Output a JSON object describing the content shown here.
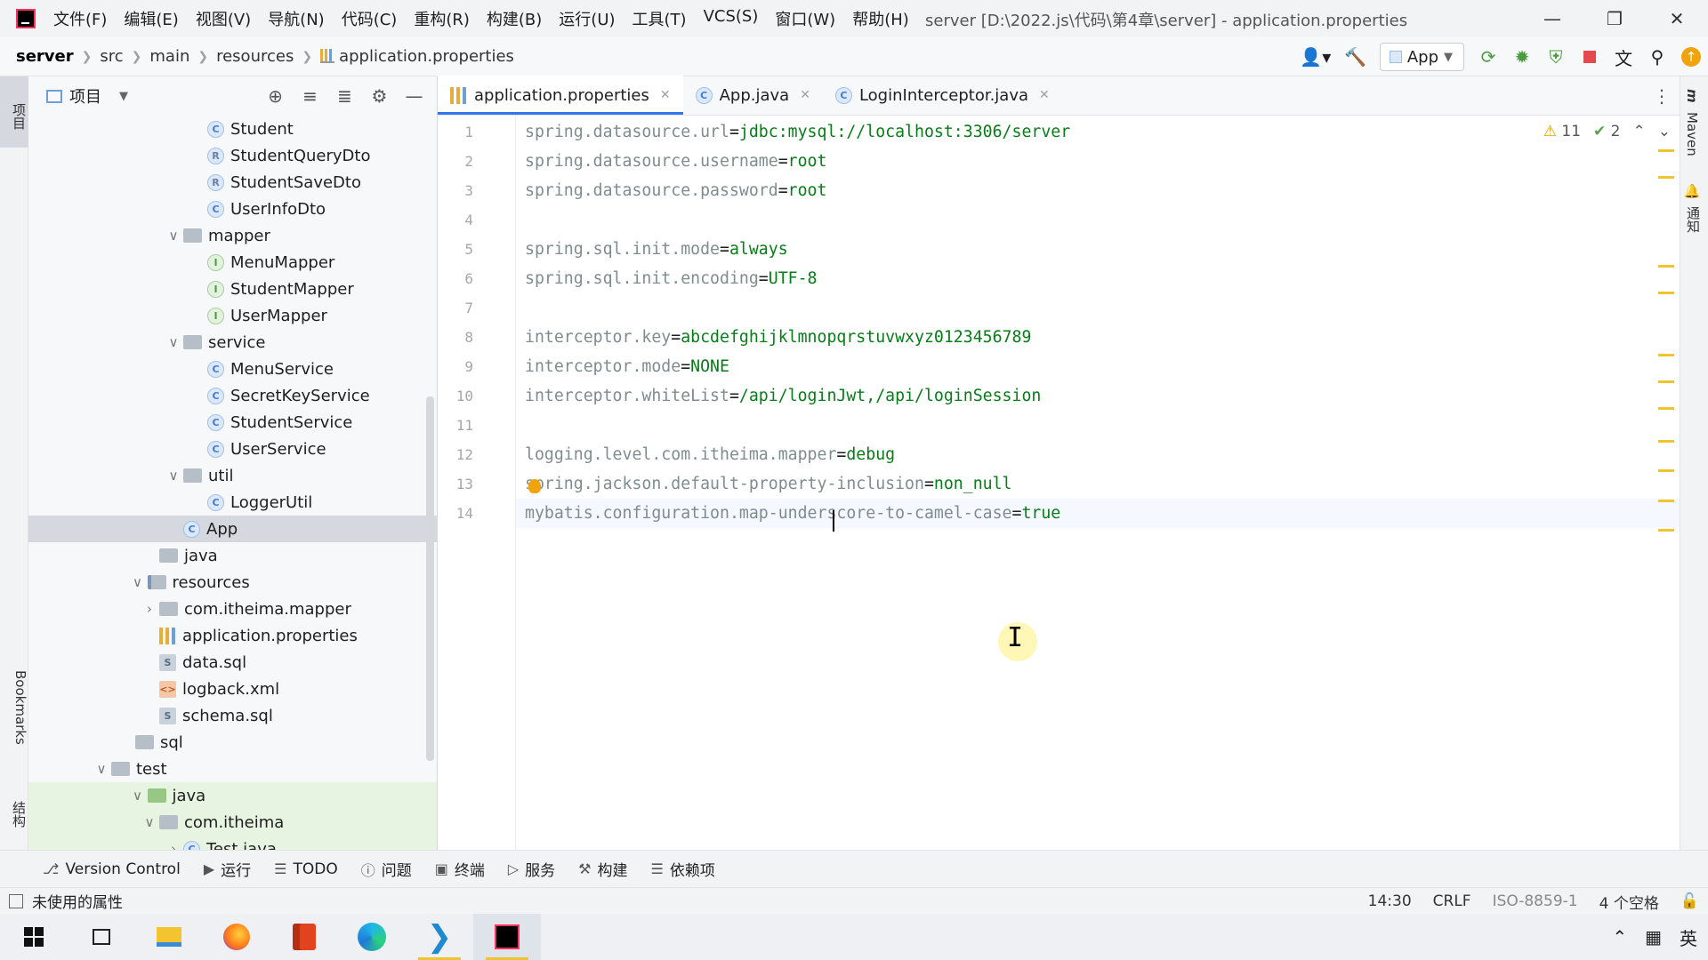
{
  "titlebar": {
    "menus": [
      "文件(F)",
      "编辑(E)",
      "视图(V)",
      "导航(N)",
      "代码(C)",
      "重构(R)",
      "构建(B)",
      "运行(U)",
      "工具(T)",
      "VCS(S)",
      "窗口(W)",
      "帮助(H)"
    ],
    "window_title": "server [D:\\2022.js\\代码\\第4章\\server] - application.properties"
  },
  "navbar": {
    "crumbs": [
      "server",
      "src",
      "main",
      "resources",
      "application.properties"
    ],
    "run_config": "App"
  },
  "left_stripe": {
    "project": "项目",
    "bookmarks": "Bookmarks",
    "structure": "结构"
  },
  "right_stripe": {
    "maven": "Maven",
    "notifications": "通知"
  },
  "project_panel": {
    "title": "项目",
    "tree": [
      {
        "label": "Student",
        "icon": "class",
        "indent": 3,
        "chev": ""
      },
      {
        "label": "StudentQueryDto",
        "icon": "record",
        "indent": 3,
        "chev": ""
      },
      {
        "label": "StudentSaveDto",
        "icon": "record",
        "indent": 3,
        "chev": ""
      },
      {
        "label": "UserInfoDto",
        "icon": "class",
        "indent": 3,
        "chev": ""
      },
      {
        "label": "mapper",
        "icon": "folder",
        "indent": 2,
        "chev": "open"
      },
      {
        "label": "MenuMapper",
        "icon": "interface",
        "indent": 3,
        "chev": ""
      },
      {
        "label": "StudentMapper",
        "icon": "interface",
        "indent": 3,
        "chev": ""
      },
      {
        "label": "UserMapper",
        "icon": "interface",
        "indent": 3,
        "chev": ""
      },
      {
        "label": "service",
        "icon": "folder",
        "indent": 2,
        "chev": "open"
      },
      {
        "label": "MenuService",
        "icon": "class",
        "indent": 3,
        "chev": ""
      },
      {
        "label": "SecretKeyService",
        "icon": "class",
        "indent": 3,
        "chev": ""
      },
      {
        "label": "StudentService",
        "icon": "class",
        "indent": 3,
        "chev": ""
      },
      {
        "label": "UserService",
        "icon": "class",
        "indent": 3,
        "chev": ""
      },
      {
        "label": "util",
        "icon": "folder",
        "indent": 2,
        "chev": "open"
      },
      {
        "label": "LoggerUtil",
        "icon": "class",
        "indent": 3,
        "chev": ""
      },
      {
        "label": "App",
        "icon": "app",
        "indent": 2,
        "chev": "",
        "selected": true
      },
      {
        "label": "java",
        "icon": "folder",
        "indent": 1,
        "chev": ""
      },
      {
        "label": "resources",
        "icon": "folder-src",
        "indent": 0.5,
        "chev": "open"
      },
      {
        "label": "com.itheima.mapper",
        "icon": "folder",
        "indent": 1,
        "chev": "closed"
      },
      {
        "label": "application.properties",
        "icon": "props",
        "indent": 1,
        "chev": ""
      },
      {
        "label": "data.sql",
        "icon": "sql",
        "indent": 1,
        "chev": ""
      },
      {
        "label": "logback.xml",
        "icon": "xml",
        "indent": 1,
        "chev": ""
      },
      {
        "label": "schema.sql",
        "icon": "sql",
        "indent": 1,
        "chev": ""
      },
      {
        "label": "sql",
        "icon": "folder",
        "indent": 0,
        "chev": ""
      },
      {
        "label": "test",
        "icon": "folder",
        "indent": -1,
        "chev": "open"
      },
      {
        "label": "java",
        "icon": "folder-test",
        "indent": 0.5,
        "chev": "open",
        "tested": true
      },
      {
        "label": "com.itheima",
        "icon": "folder",
        "indent": 1,
        "chev": "open",
        "tested": true
      },
      {
        "label": "Test.java",
        "icon": "class",
        "indent": 2,
        "chev": "closed",
        "tested": true
      }
    ]
  },
  "tabs": [
    {
      "label": "application.properties",
      "icon": "props",
      "active": true
    },
    {
      "label": "App.java",
      "icon": "app",
      "active": false
    },
    {
      "label": "LoginInterceptor.java",
      "icon": "class",
      "active": false
    }
  ],
  "editor": {
    "inspections": {
      "warnings": "11",
      "ok": "2"
    },
    "current_line": 14,
    "lines": [
      {
        "key": "spring.datasource.url",
        "value": "jdbc:mysql://localhost:3306/server"
      },
      {
        "key": "spring.datasource.username",
        "value": "root"
      },
      {
        "key": "spring.datasource.password",
        "value": "root"
      },
      {
        "key": "",
        "value": ""
      },
      {
        "key": "spring.sql.init.mode",
        "value": "always"
      },
      {
        "key": "spring.sql.init.encoding",
        "value": "UTF-8"
      },
      {
        "key": "",
        "value": ""
      },
      {
        "key": "interceptor.key",
        "value": "abcdefghijklmnopqrstuvwxyz0123456789"
      },
      {
        "key": "interceptor.mode",
        "value": "NONE"
      },
      {
        "key": "interceptor.whiteList",
        "value": "/api/loginJwt,/api/loginSession"
      },
      {
        "key": "",
        "value": ""
      },
      {
        "key": "logging.level.com.itheima.mapper",
        "value": "debug"
      },
      {
        "key": "spring.jackson.default-property-inclusion",
        "value": "non_null"
      },
      {
        "key": "mybatis.configuration.map-underscore-to-camel-case",
        "value": "true"
      }
    ]
  },
  "toolwindows": [
    {
      "label": "Version Control",
      "icon": "branch-icon"
    },
    {
      "label": "运行",
      "icon": "run-icon"
    },
    {
      "label": "TODO",
      "icon": "todo-icon"
    },
    {
      "label": "问题",
      "icon": "problems-icon"
    },
    {
      "label": "终端",
      "icon": "terminal-icon"
    },
    {
      "label": "服务",
      "icon": "services-icon"
    },
    {
      "label": "构建",
      "icon": "build-icon"
    },
    {
      "label": "依赖项",
      "icon": "dependencies-icon"
    }
  ],
  "statusbar": {
    "message": "未使用的属性",
    "position": "14:30",
    "line_sep": "CRLF",
    "encoding": "ISO-8859-1",
    "indent": "4 个空格"
  },
  "taskbar": {
    "apps": [
      "windows-start",
      "task-view",
      "file-explorer",
      "firefox",
      "office",
      "edge",
      "vscode",
      "intellij"
    ],
    "tray_lang": "英"
  }
}
